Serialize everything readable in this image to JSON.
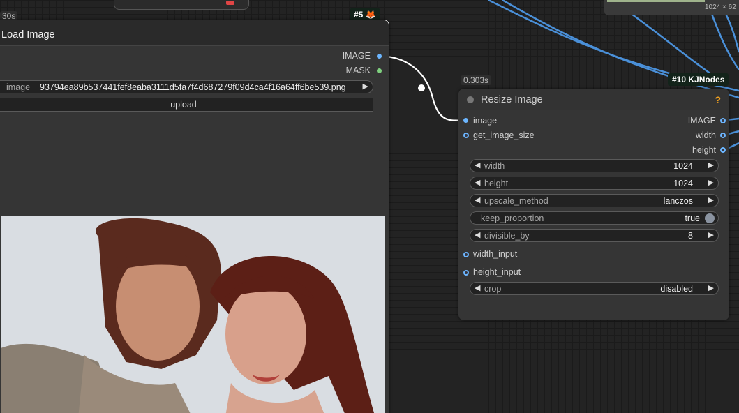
{
  "top_right_node": {
    "dims": "1024 × 62"
  },
  "load_image": {
    "timing": "30s",
    "badge": "#5 🦊",
    "title": "Load Image",
    "outputs": [
      "IMAGE",
      "MASK"
    ],
    "image_widget_label": "image",
    "image_widget_value": "93794ea89b537441fef8eaba3111d5fa7f4d687279f09d4ca4f16a64ff6be539.png",
    "upload_label": "upload"
  },
  "resize_image": {
    "timing": "0.303s",
    "badge": "#10 KJNodes",
    "title": "Resize Image",
    "help": "?",
    "inputs": [
      "image",
      "get_image_size"
    ],
    "outputs": [
      "IMAGE",
      "width",
      "height"
    ],
    "widgets": {
      "width": {
        "label": "width",
        "value": "1024"
      },
      "height": {
        "label": "height",
        "value": "1024"
      },
      "upscale_method": {
        "label": "upscale_method",
        "value": "lanczos"
      },
      "keep_proportion": {
        "label": "keep_proportion",
        "value": "true"
      },
      "divisible_by": {
        "label": "divisible_by",
        "value": "8"
      },
      "crop": {
        "label": "crop",
        "value": "disabled"
      }
    },
    "extra_inputs": [
      "width_input",
      "height_input"
    ]
  },
  "colors": {
    "image_port": "#6cb6ff",
    "mask_port": "#7fd07f",
    "wire": "#4a90d9",
    "badge_bg": "#13231a",
    "help": "#f0a020"
  },
  "icons": {
    "arrow_left": "◀",
    "arrow_right": "▶"
  }
}
